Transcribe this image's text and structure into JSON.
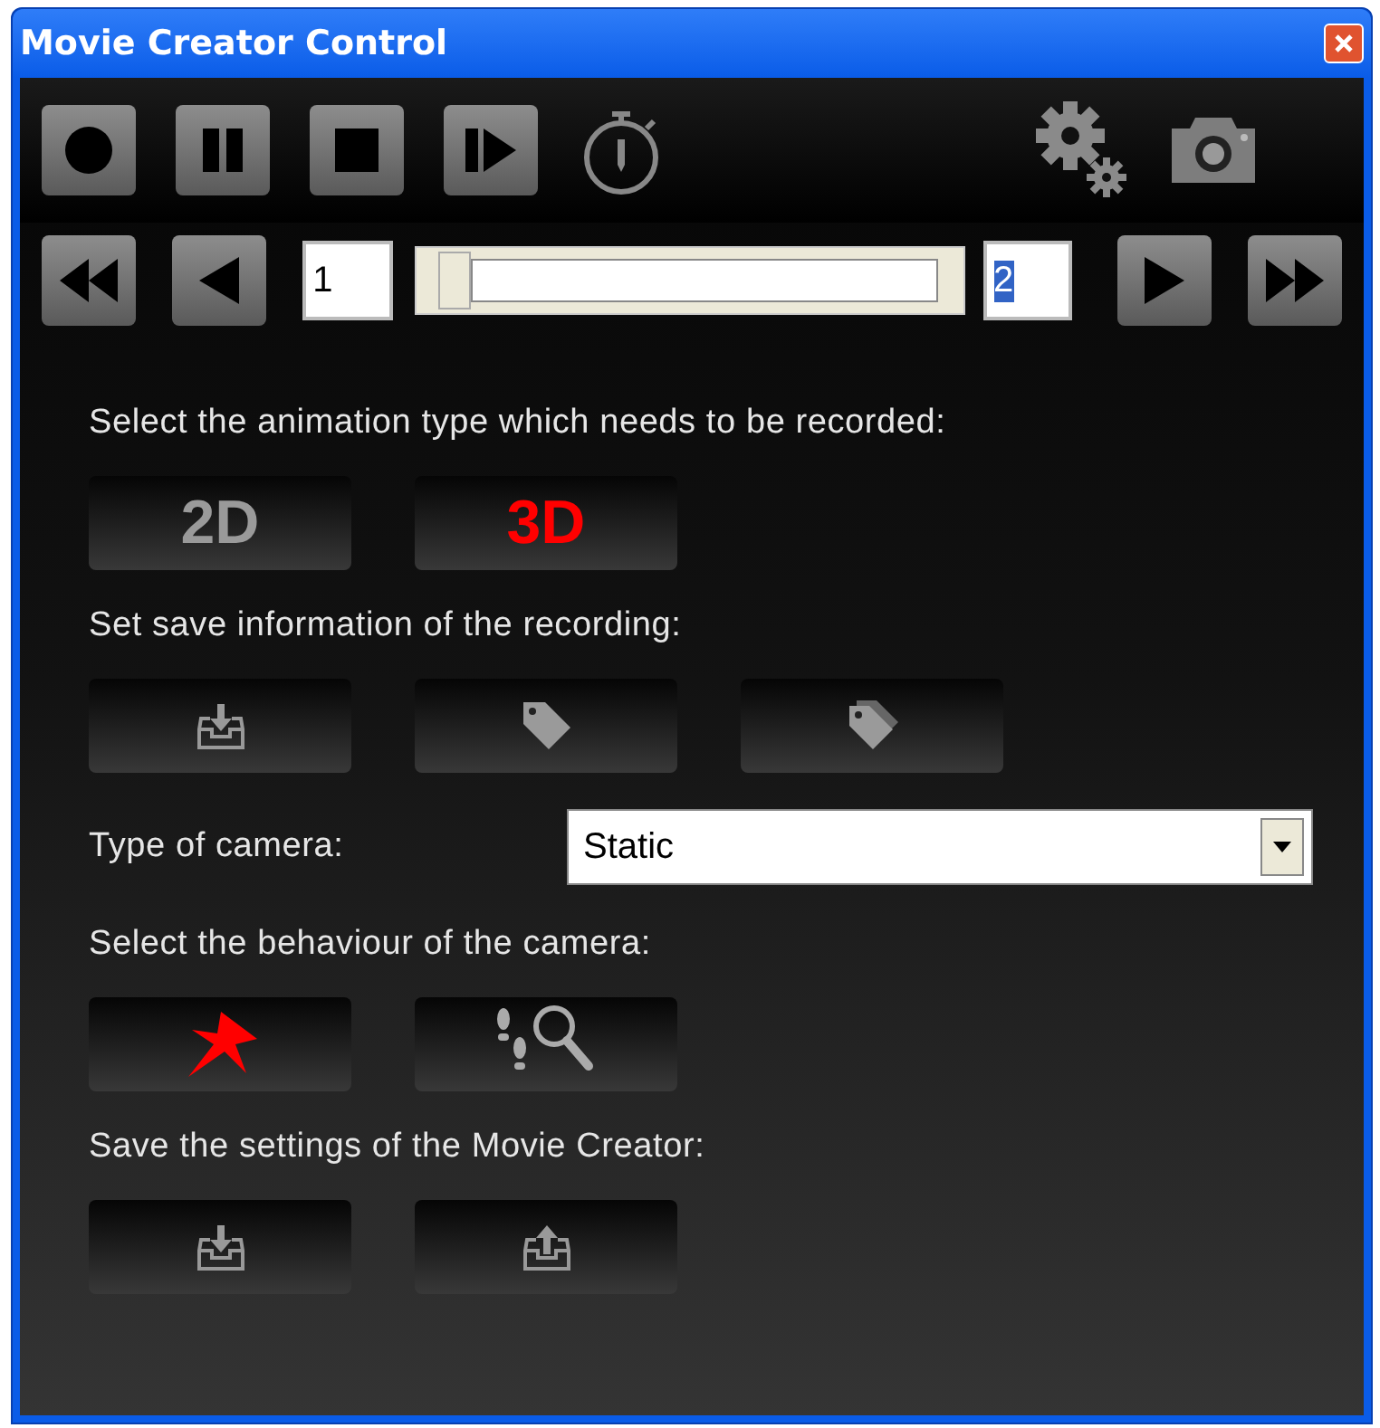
{
  "window": {
    "title": "Movie Creator Control"
  },
  "toolbar": [
    {
      "kind": "record"
    },
    {
      "kind": "pause"
    },
    {
      "kind": "stop"
    },
    {
      "kind": "step"
    },
    {
      "kind": "timer"
    },
    {
      "kind": "settings"
    },
    {
      "kind": "snapshot"
    }
  ],
  "navigation": {
    "start_frame": "1",
    "end_frame": "2",
    "end_frame_selected": true,
    "level": 0.0
  },
  "sections": [
    {
      "label": "Select the animation type which needs to be recorded:",
      "buttons": [
        {
          "kind": "text",
          "text": "2D",
          "selected": false
        },
        {
          "kind": "text",
          "text": "3D",
          "selected": true
        }
      ]
    },
    {
      "label": "Set save information of the recording:",
      "buttons": [
        {
          "kind": "download-tray"
        },
        {
          "kind": "tag"
        },
        {
          "kind": "tags"
        }
      ]
    },
    {
      "label": "Type of camera:",
      "dropdown": {
        "value": "Static"
      }
    },
    {
      "label": "Select the behaviour of the camera:",
      "buttons": [
        {
          "kind": "pin"
        },
        {
          "kind": "footsteps-search"
        }
      ]
    },
    {
      "label": "Save the settings of the Movie Creator:",
      "buttons": [
        {
          "kind": "download-tray"
        },
        {
          "kind": "upload-tray"
        }
      ]
    }
  ]
}
